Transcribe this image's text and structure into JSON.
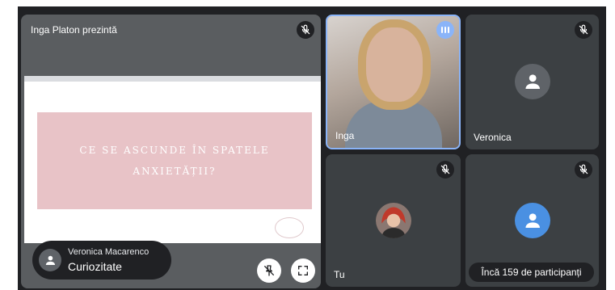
{
  "presentation": {
    "title": "Inga Platon prezintă",
    "slide_title": "CE SE ASCUNDE ÎN SPATELE\nANXIETĂȚII?",
    "speaker_name": "Veronica Macarenco",
    "speaker_caption": "Curiozitate"
  },
  "participants": [
    {
      "name": "Inga",
      "state": "speaking"
    },
    {
      "name": "Veronica",
      "state": "muted"
    },
    {
      "name": "Tu",
      "state": "muted"
    }
  ],
  "more_participants_label": "Încă 159 de participanți",
  "icons": {
    "mute": "mic-off-icon",
    "speaking": "audio-level-icon",
    "unpin": "pin-off-icon",
    "fullscreen": "fullscreen-icon",
    "avatar": "person-icon"
  },
  "colors": {
    "stage": "#202124",
    "tile": "#3c4043",
    "accent": "#8ab4f8",
    "slide_band": "#e8c3c7",
    "avatar_grey": "#5f6368",
    "avatar_blue": "#4a90e2"
  }
}
